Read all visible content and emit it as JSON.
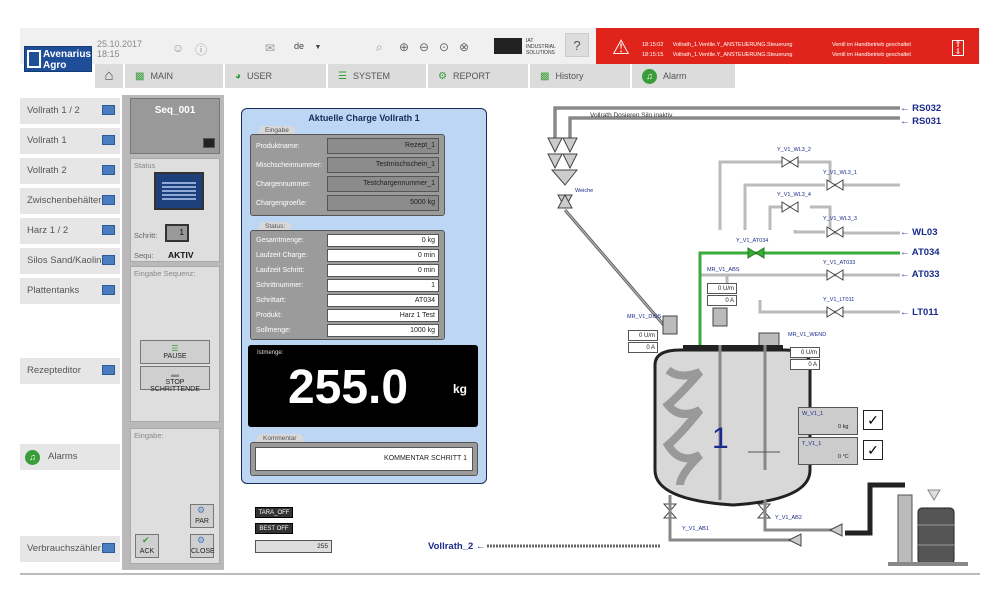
{
  "header": {
    "logo_line1": "Avenarius",
    "logo_line2": "Agro",
    "date": "25.10.2017",
    "time": "18:15",
    "language": "de",
    "brand_sub1": "IAT",
    "brand_sub2": "INDUSTRIAL",
    "brand_sub3": "SOLUTIONS",
    "help": "?"
  },
  "alarm_bar": {
    "rows": [
      {
        "time": "18:15:02",
        "text": "Vollrath_1.Ventile.Y_ANSTEUERUNG.Steuerung",
        "msg": "Ventil im Handbetrieb geschaltet"
      },
      {
        "time": "18:15:15",
        "text": "Vollrath_1.Ventile.Y_ANSTEUERUNG.Steuerung",
        "msg": "Ventil im Handbetrieb geschaltet"
      }
    ],
    "color": "#e0241b"
  },
  "nav": {
    "tabs": [
      {
        "label": "MAIN",
        "icon": "bar-chart-icon"
      },
      {
        "label": "USER",
        "icon": "pie-chart-icon"
      },
      {
        "label": "SYSTEM",
        "icon": "sliders-icon"
      },
      {
        "label": "REPORT",
        "icon": "gears-icon"
      },
      {
        "label": "History",
        "icon": "bar-chart-icon"
      },
      {
        "label": "Alarm",
        "icon": "bell-icon"
      }
    ]
  },
  "sidebar": {
    "items": [
      "Vollrath 1 / 2",
      "Vollrath 1",
      "Vollrath 2",
      "Zwischenbehälter",
      "Harz 1 / 2",
      "Silos Sand/Kaolin",
      "Plattentanks"
    ],
    "rezepteditor": "Rezepteditor",
    "alarms": "Alarms",
    "verbrauch": "Verbrauchszähler"
  },
  "sequence": {
    "name": "Seq_001",
    "status_label": "Status",
    "schritt_label": "Schritt:",
    "schritt_value": "1",
    "sequ_label": "Sequ:",
    "sequ_value": "AKTIV",
    "eingabe_sequenz": "Eingabe Sequenz:",
    "pause": "PAUSE",
    "stop": "STOP SCHRITTENDE",
    "eingabe": "Eingabe:",
    "par": "PAR",
    "ack": "ACK",
    "close": "CLOSE"
  },
  "charge": {
    "title": "Aktuelle Charge Vollrath 1",
    "eingabe_tab": "Eingabe",
    "fields": [
      {
        "label": "Produktname:",
        "value": "Rezept_1"
      },
      {
        "label": "Mischscheinnummer:",
        "value": "Testmischschein_1"
      },
      {
        "label": "Chargennummer:",
        "value": "Testchargennummer_1"
      },
      {
        "label": "Chargengroeße:",
        "value": "5000 kg"
      }
    ],
    "status_tab": "Status:",
    "status": [
      {
        "label": "Gesamtmenge:",
        "value": "0 kg"
      },
      {
        "label": "Laufzeit Charge:",
        "value": "0 min"
      },
      {
        "label": "Laufzeit Schritt:",
        "value": "0 min"
      },
      {
        "label": "Schrittnummer:",
        "value": "1"
      },
      {
        "label": "Schrittart:",
        "value": "AT034"
      },
      {
        "label": "Produkt:",
        "value": "Harz 1 Test"
      },
      {
        "label": "Sollmenge:",
        "value": "1000 kg"
      }
    ],
    "istmenge_label": "Istmenge:",
    "istmenge_value": "255.0",
    "istmenge_unit": "kg",
    "kommentar_tab": "Kommentar",
    "kommentar": "KOMMENTAR SCHRITT 1"
  },
  "bottom_ctrl": {
    "tara": "TARA_OFF",
    "best": "BEST OFF",
    "value": "255"
  },
  "process": {
    "rs032": "← RS032",
    "rs031": "← RS031",
    "silo_label": "Vollrath Dosieren Silo inaktiv",
    "weiche": "Weiche",
    "wl03": "← WL03",
    "at034": "← AT034",
    "at033": "← AT033",
    "lt011": "← LT011",
    "vollrath2": "Vollrath_2 ←",
    "valves": [
      "Y_V1_WL3_2",
      "Y_V1_WL3_1",
      "Y_V1_WL3_4",
      "Y_V1_WL3_3",
      "Y_V1_AT034",
      "Y_V1_AT033",
      "Y_V1_LT011",
      "Y_V1_AB1",
      "Y_V1_AB2"
    ],
    "mr_abs": "MR_V1_ABS",
    "mr_diss": "MR_V1_DISS",
    "mr_wend": "MR_V1_WEND",
    "abs_vals": [
      "0 U/m",
      "0 A"
    ],
    "diss_vals": [
      "0 U/m",
      "0 A"
    ],
    "wend_vals": [
      "0 U/m",
      "0 A"
    ],
    "tank_number": "1",
    "w_label": "W_V1_1",
    "w_value": "0 kg",
    "t_label": "T_V1_1",
    "t_value": "0 °C",
    "accent_green": "#3aab3a"
  }
}
